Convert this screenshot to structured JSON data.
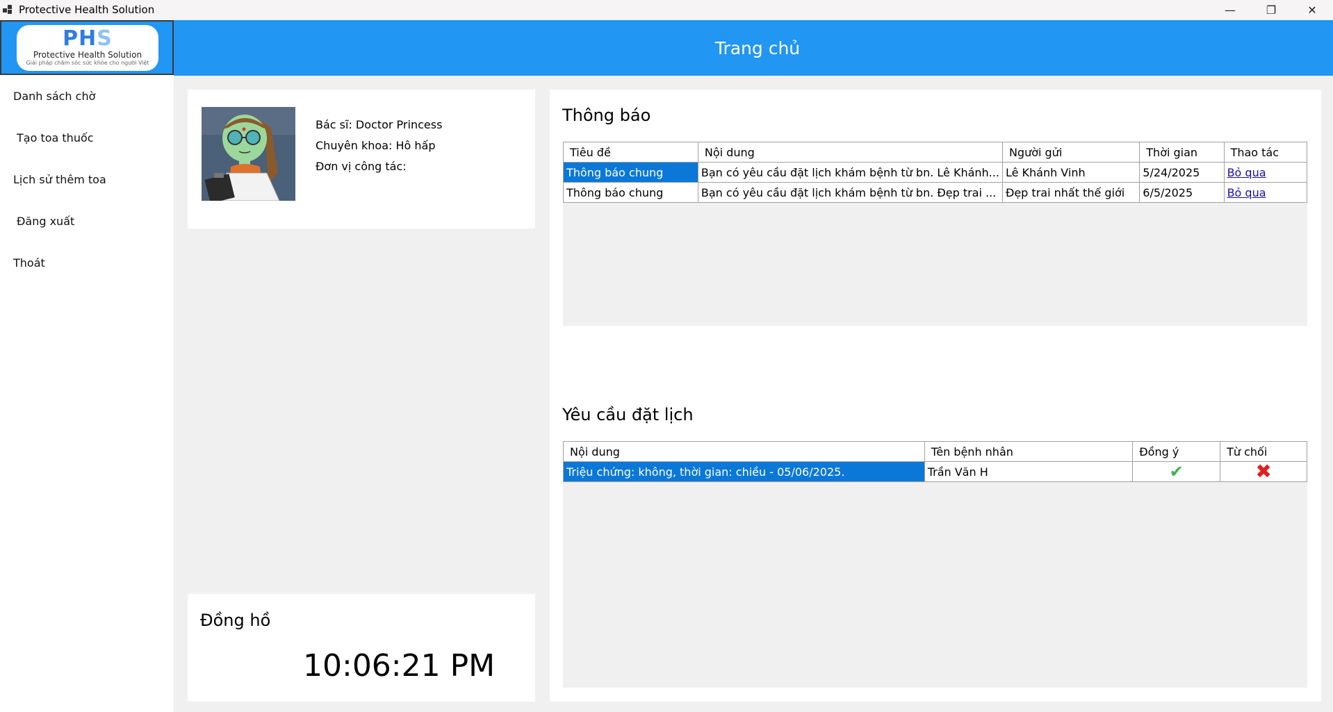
{
  "window": {
    "title": "Protective Health Solution",
    "minimize_icon": "minimize-icon",
    "restore_icon": "restore-icon",
    "close_icon": "close-icon"
  },
  "logo": {
    "letter_p": "P",
    "letter_h": "H",
    "letter_s": "S",
    "name": "Protective Health Solution",
    "tagline": "Giải pháp chăm sóc sức khỏe cho người Việt"
  },
  "sidebar": {
    "items": [
      {
        "label": "Danh sách chờ"
      },
      {
        "label": "Tạo toa thuốc"
      },
      {
        "label": "Lịch sử thêm toa"
      },
      {
        "label": "Đăng xuất"
      },
      {
        "label": "Thoát"
      }
    ]
  },
  "header": {
    "title": "Trang chủ"
  },
  "profile": {
    "doctor": "Bác sĩ: Doctor Princess",
    "specialty": "Chuyên khoa: Hô hấp",
    "workplace": "Đơn vị công tác:"
  },
  "clock": {
    "title": "Đồng hồ",
    "time": "10:06:21 PM"
  },
  "notifications": {
    "title": "Thông báo",
    "columns": [
      "Tiêu đề",
      "Nội dung",
      "Người gửi",
      "Thời gian",
      "Thao tác"
    ],
    "rows": [
      {
        "title": "Thông báo chung",
        "content": "Bạn có yêu cầu đặt lịch khám bệnh từ bn. Lê Khánh...",
        "sender": "Lê Khánh Vinh",
        "time": "5/24/2025",
        "action": "Bỏ qua"
      },
      {
        "title": "Thông báo chung",
        "content": "Bạn có yêu cầu đặt lịch khám bệnh từ bn. Đẹp trai ...",
        "sender": "Đẹp trai nhất thế giới",
        "time": "6/5/2025",
        "action": "Bỏ qua"
      }
    ]
  },
  "appointments": {
    "title": "Yêu cầu đặt lịch",
    "columns": [
      "Nội dung",
      "Tên bệnh nhân",
      "Đồng ý",
      "Từ chối"
    ],
    "rows": [
      {
        "content": "Triệu chứng: không, thời gian: chiều - 05/06/2025.",
        "patient": "Trần Văn H",
        "accept_icon": "check-icon",
        "reject_icon": "x-icon"
      }
    ]
  },
  "colors": {
    "primary": "#2196f3",
    "selection": "#0b78d7",
    "background": "#f0f0f0",
    "accept": "#3cb44a",
    "reject": "#e02020"
  }
}
